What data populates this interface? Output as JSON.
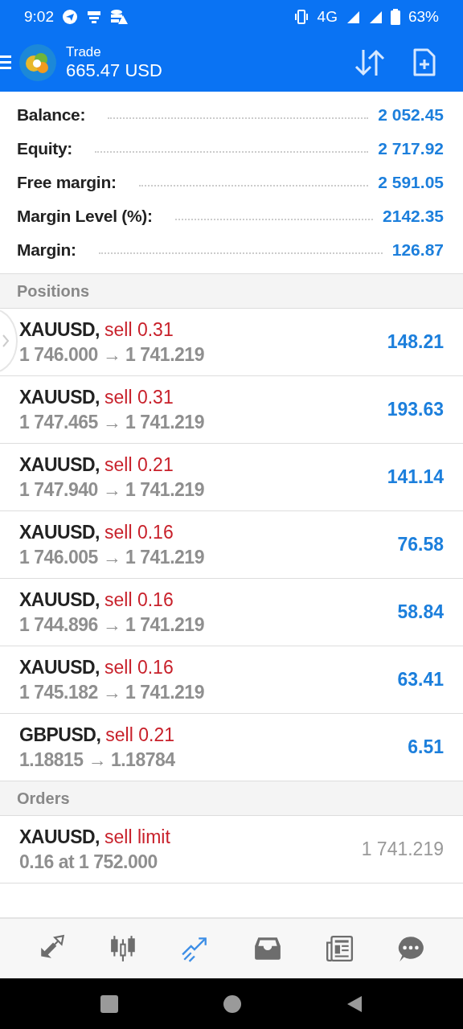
{
  "status_bar": {
    "time": "9:02",
    "network": "4G",
    "battery": "63%"
  },
  "header": {
    "title": "Trade",
    "balance": "665.47 USD"
  },
  "summary": [
    {
      "label": "Balance:",
      "value": "2 052.45"
    },
    {
      "label": "Equity:",
      "value": "2 717.92"
    },
    {
      "label": "Free margin:",
      "value": "2 591.05"
    },
    {
      "label": "Margin Level (%):",
      "value": "2142.35"
    },
    {
      "label": "Margin:",
      "value": "126.87"
    }
  ],
  "positions": {
    "title": "Positions",
    "items": [
      {
        "symbol": "XAUUSD,",
        "side": "sell 0.31",
        "prices": "1 746.000 → 1 741.219",
        "profit": "148.21"
      },
      {
        "symbol": "XAUUSD,",
        "side": "sell 0.31",
        "prices": "1 747.465 → 1 741.219",
        "profit": "193.63"
      },
      {
        "symbol": "XAUUSD,",
        "side": "sell 0.21",
        "prices": "1 747.940 → 1 741.219",
        "profit": "141.14"
      },
      {
        "symbol": "XAUUSD,",
        "side": "sell 0.16",
        "prices": "1 746.005 → 1 741.219",
        "profit": "76.58"
      },
      {
        "symbol": "XAUUSD,",
        "side": "sell 0.16",
        "prices": "1 744.896 → 1 741.219",
        "profit": "58.84"
      },
      {
        "symbol": "XAUUSD,",
        "side": "sell 0.16",
        "prices": "1 745.182 → 1 741.219",
        "profit": "63.41"
      },
      {
        "symbol": "GBPUSD,",
        "side": "sell 0.21",
        "prices": "1.18815 → 1.18784",
        "profit": "6.51"
      }
    ]
  },
  "orders": {
    "title": "Orders",
    "items": [
      {
        "symbol": "XAUUSD,",
        "side": "sell limit",
        "details": "0.16 at 1 752.000",
        "price": "1 741.219"
      }
    ]
  },
  "bottom_nav": [
    {
      "kind": "quotes",
      "selected": false
    },
    {
      "kind": "chart",
      "selected": false
    },
    {
      "kind": "trade",
      "selected": true
    },
    {
      "kind": "history",
      "selected": false
    },
    {
      "kind": "news",
      "selected": false
    },
    {
      "kind": "messages",
      "selected": false
    }
  ]
}
